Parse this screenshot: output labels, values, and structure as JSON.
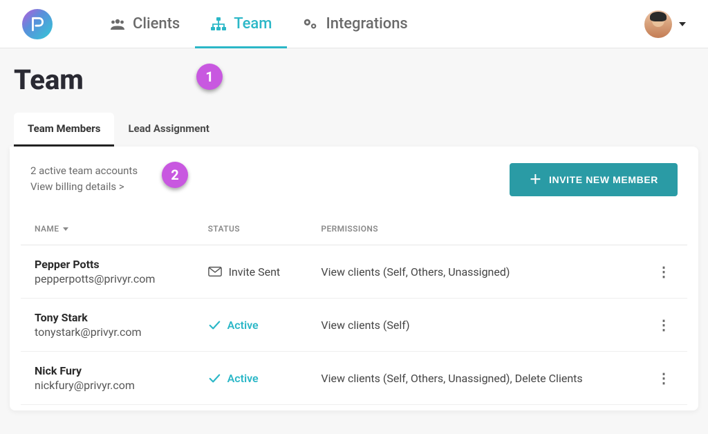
{
  "nav": {
    "items": [
      {
        "label": "Clients"
      },
      {
        "label": "Team"
      },
      {
        "label": "Integrations"
      }
    ],
    "active_index": 1
  },
  "page": {
    "title": "Team"
  },
  "annotations": {
    "badge1": "1",
    "badge2": "2"
  },
  "tabs": [
    {
      "label": "Team Members"
    },
    {
      "label": "Lead Assignment"
    }
  ],
  "tabs_active_index": 0,
  "summary": {
    "active_accounts_text": "2 active team accounts",
    "billing_link_text": "View billing details >"
  },
  "invite_button": {
    "label": "INVITE NEW MEMBER"
  },
  "table": {
    "headers": {
      "name": "NAME",
      "status": "STATUS",
      "permissions": "PERMISSIONS"
    },
    "rows": [
      {
        "name": "Pepper Potts",
        "email": "pepperpotts@privyr.com",
        "status_kind": "invite",
        "status_text": "Invite Sent",
        "permissions": "View clients (Self, Others, Unassigned)"
      },
      {
        "name": "Tony Stark",
        "email": "tonystark@privyr.com",
        "status_kind": "active",
        "status_text": "Active",
        "permissions": "View clients (Self)"
      },
      {
        "name": "Nick Fury",
        "email": "nickfury@privyr.com",
        "status_kind": "active",
        "status_text": "Active",
        "permissions": "View clients (Self, Others, Unassigned), Delete Clients"
      }
    ]
  }
}
